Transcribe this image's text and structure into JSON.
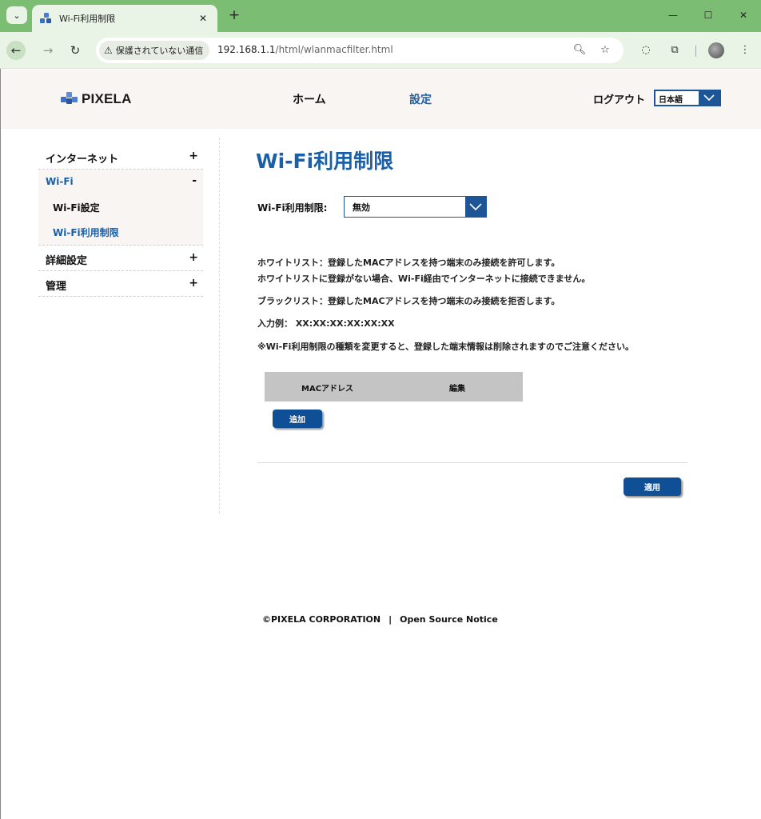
{
  "browser": {
    "tab_title": "Wi-Fi利用制限",
    "tab_close": "✕",
    "new_tab": "+",
    "security_label": "保護されていない通信",
    "url_host": "192.168.1.1",
    "url_path": "/html/wlanmacfilter.html",
    "icons": [
      "tab-list-icon",
      "back-icon",
      "forward-icon",
      "reload-icon",
      "warning-icon",
      "zoom-icon",
      "star-icon",
      "extension-icon",
      "puzzle-icon",
      "avatar",
      "more-icon"
    ]
  },
  "header": {
    "logo": "PIXELA",
    "nav_home": "ホーム",
    "nav_settings": "設定",
    "logout": "ログアウト",
    "language": "日本語"
  },
  "sidebar": {
    "internet": {
      "label": "インターネット",
      "toggle": "+"
    },
    "wifi": {
      "label": "Wi-Fi",
      "toggle": "-",
      "sub": [
        "Wi-Fi設定",
        "Wi-Fi利用制限"
      ]
    },
    "advanced": {
      "label": "詳細設定",
      "toggle": "+"
    },
    "admin": {
      "label": "管理",
      "toggle": "+"
    }
  },
  "main": {
    "title": "Wi-Fi利用制限",
    "restrict_label": "Wi-Fi利用制限:",
    "restrict_value": "無効",
    "desc_whitelist_1": "ホワイトリスト：登録したMACアドレスを持つ端末のみ接続を許可します。",
    "desc_whitelist_2": "ホワイトリストに登録がない場合、Wi-Fi経由でインターネットに接続できません。",
    "desc_blacklist": "ブラックリスト：登録したMACアドレスを持つ端末のみ接続を拒否します。",
    "desc_example": "入力例： XX:XX:XX:XX:XX:XX",
    "desc_note": "※Wi-Fi利用制限の種類を変更すると、登録した端末情報は削除されますのでご注意ください。",
    "table_col_mac": "MACアドレス",
    "table_col_edit": "編集",
    "add_button": "追加",
    "apply_button": "適用"
  },
  "footer": {
    "copyright": "©PIXELA  CORPORATION",
    "separator": "|",
    "oss_notice": "Open Source Notice"
  },
  "colors": {
    "tabbar": "#7cbd74",
    "toolbar": "#e9f4e6",
    "accent_blue": "#1b5fa6",
    "button_blue": "#0e4f96",
    "header_bg": "#f9f5f2",
    "table_header": "#c4c4c4"
  }
}
